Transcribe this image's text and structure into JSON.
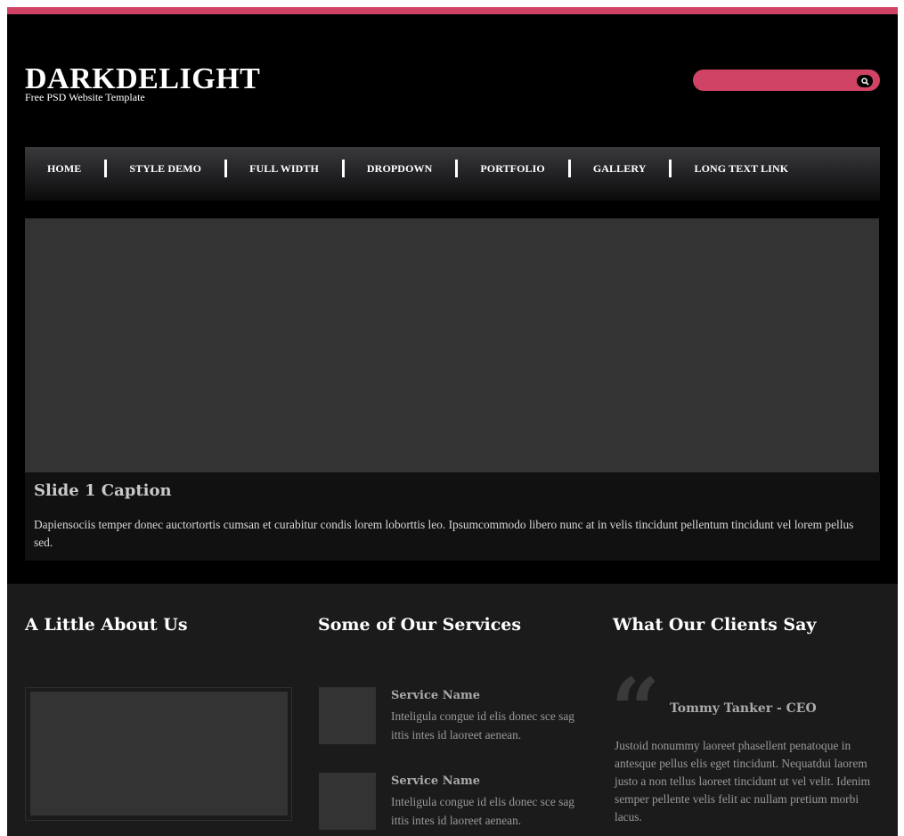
{
  "theme": {
    "accent": "#d04364",
    "background": "#000000",
    "panel": "#1b1b1b"
  },
  "header": {
    "logo": "DARKDELIGHT",
    "tagline": "Free PSD Website Template",
    "search": {
      "placeholder": "",
      "button_icon": "search-icon"
    }
  },
  "nav": {
    "items": [
      {
        "label": "HOME"
      },
      {
        "label": "STYLE DEMO"
      },
      {
        "label": "FULL WIDTH"
      },
      {
        "label": "DROPDOWN"
      },
      {
        "label": "PORTFOLIO"
      },
      {
        "label": "GALLERY"
      },
      {
        "label": "LONG TEXT LINK"
      }
    ]
  },
  "slider": {
    "caption_title": "Slide 1 Caption",
    "caption_text": "Dapiensociis temper donec auctortortis cumsan et curabitur condis lorem loborttis leo. Ipsumcommodo libero nunc at in velis tincidunt pellentum tincidunt vel lorem pellus sed."
  },
  "about": {
    "title": "A Little About Us"
  },
  "services": {
    "title": "Some of Our Services",
    "items": [
      {
        "name": "Service Name",
        "description": "Inteligula congue id elis donec sce sag ittis intes id laoreet aenean."
      },
      {
        "name": "Service Name",
        "description": "Inteligula congue id elis donec sce sag ittis intes id laoreet aenean."
      }
    ]
  },
  "testimonials": {
    "title": "What Our Clients Say",
    "quote_mark": "“",
    "client_name": "Tommy Tanker - CEO",
    "quote": "Justoid nonummy laoreet phasellent penatoque in antesque pellus elis eget tincidunt. Nequatdui laorem justo a non tellus laoreet tincidunt ut vel velit. Idenim semper pellente velis felit ac nullam pretium morbi lacus."
  }
}
